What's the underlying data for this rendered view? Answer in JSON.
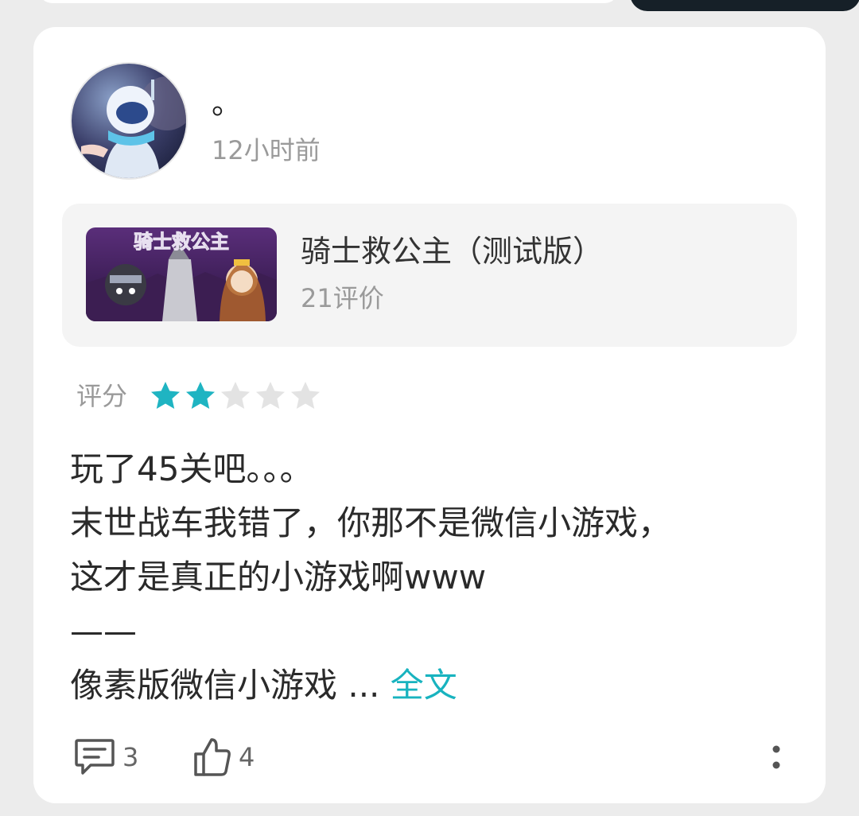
{
  "post": {
    "username": "。",
    "time": "12小时前"
  },
  "game": {
    "title": "骑士救公主（测试版）",
    "reviews": "21评价",
    "thumb_text": "骑士救公主"
  },
  "rating": {
    "label": "评分",
    "value": 2,
    "max": 5,
    "filled_color": "#1fb4c2",
    "empty_color": "#e3e3e3"
  },
  "review": {
    "lines": [
      "玩了45关吧。。。",
      "末世战车我错了，你那不是微信小游戏，",
      "这才是真正的小游戏啊www",
      "——",
      "像素版微信小游戏 ..."
    ],
    "more_label": "全文"
  },
  "actions": {
    "comments": "3",
    "likes": "4"
  },
  "colors": {
    "accent": "#18b3bf"
  }
}
